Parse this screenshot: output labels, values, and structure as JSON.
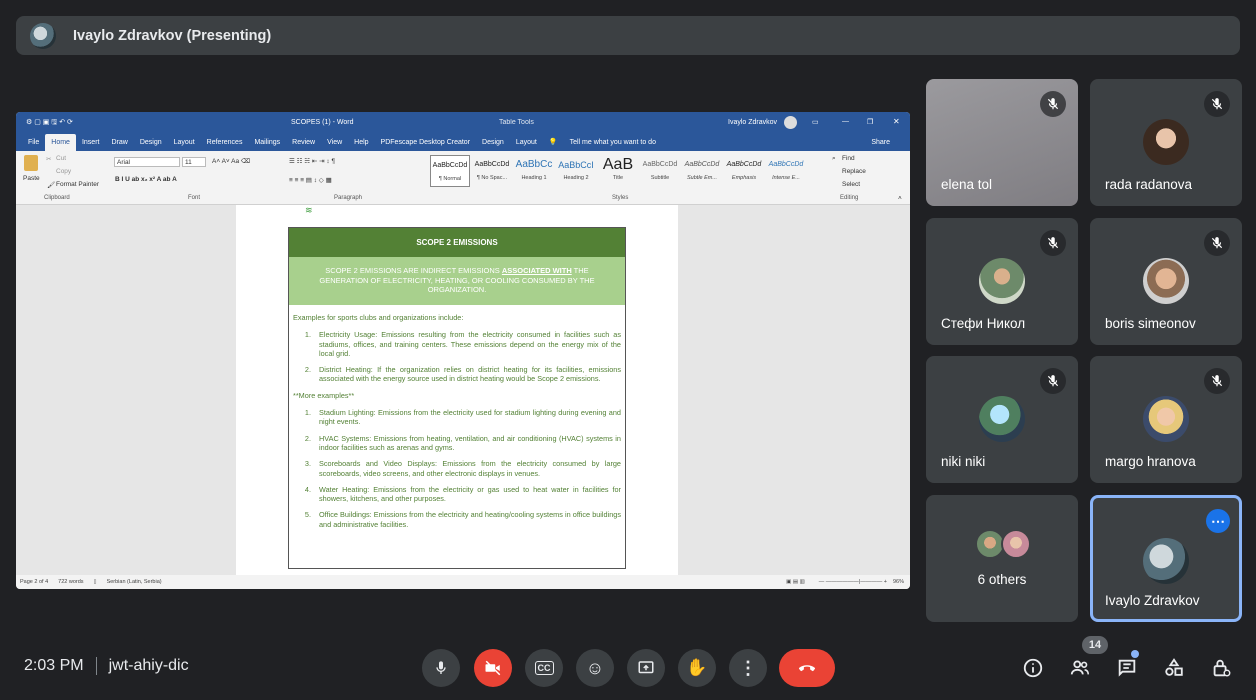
{
  "presenter": {
    "name": "Ivaylo Zdravkov (Presenting)"
  },
  "word": {
    "title": "SCOPES (1) - Word",
    "table_tools": "Table Tools",
    "user": "Ivaylo Zdravkov",
    "tabs": [
      "File",
      "Home",
      "Insert",
      "Draw",
      "Design",
      "Layout",
      "References",
      "Mailings",
      "Review",
      "View",
      "Help",
      "PDFescape Desktop Creator",
      "Design",
      "Layout"
    ],
    "tell_me": "Tell me what you want to do",
    "share": "Share",
    "clipboard": {
      "paste": "Paste",
      "cut": "Cut",
      "copy": "Copy",
      "format_painter": "Format Painter",
      "label": "Clipboard"
    },
    "font": {
      "name": "Arial",
      "size": "11",
      "label": "Font"
    },
    "paragraph_label": "Paragraph",
    "styles_label": "Styles",
    "editing": {
      "find": "Find",
      "replace": "Replace",
      "select": "Select",
      "label": "Editing"
    },
    "styles": [
      {
        "sample": "AaBbCcDd",
        "name": "¶ Normal"
      },
      {
        "sample": "AaBbCcDd",
        "name": "¶ No Spac..."
      },
      {
        "sample": "AaBbCc",
        "name": "Heading 1"
      },
      {
        "sample": "AaBbCcI",
        "name": "Heading 2"
      },
      {
        "sample": "AaB",
        "name": "Title"
      },
      {
        "sample": "AaBbCcDd",
        "name": "Subtitle"
      },
      {
        "sample": "AaBbCcDd",
        "name": "Subtle Em..."
      },
      {
        "sample": "AaBbCcDd",
        "name": "Emphasis"
      },
      {
        "sample": "AaBbCcDd",
        "name": "Intense E..."
      }
    ],
    "status": {
      "page": "Page 2 of 4",
      "words": "722 words",
      "language": "Serbian (Latin, Serbia)",
      "zoom": "96%"
    },
    "doc": {
      "heading": "SCOPE 2 EMISSIONS",
      "intro_pre": "SCOPE 2 EMISSIONS ARE INDIRECT EMISSIONS ",
      "intro_emph": "ASSOCIATED WITH",
      "intro_post": " THE GENERATION OF ELECTRICITY, HEATING, OR COOLING CONSUMED BY THE ORGANIZATION.",
      "examples_intro": "Examples for sports clubs and organizations include:",
      "list1": [
        {
          "n": "1.",
          "t": "Electricity Usage: Emissions resulting from the electricity consumed in facilities such as stadiums, offices, and training centers. These emissions depend on the energy mix of the local grid."
        },
        {
          "n": "2.",
          "t": "District Heating: If the organization relies on district heating for its facilities, emissions associated with the energy source used in district heating would be Scope 2 emissions."
        }
      ],
      "more": "**More examples**",
      "list2": [
        {
          "n": "1.",
          "t": "Stadium Lighting: Emissions from the electricity used for stadium lighting during evening and night events."
        },
        {
          "n": "2.",
          "t": "HVAC Systems: Emissions from heating, ventilation, and air conditioning (HVAC) systems in indoor facilities such as arenas and gyms."
        },
        {
          "n": "3.",
          "t": "Scoreboards and Video Displays: Emissions from the electricity consumed by large scoreboards, video screens, and other electronic displays in venues."
        },
        {
          "n": "4.",
          "t": "Water Heating: Emissions from the electricity or gas used to heat water in facilities for showers, kitchens, and other purposes."
        },
        {
          "n": "5.",
          "t": "Office Buildings: Emissions from the electricity and heating/cooling systems in office buildings and administrative facilities."
        }
      ]
    }
  },
  "participants": [
    {
      "name": "elena tol"
    },
    {
      "name": "rada radanova"
    },
    {
      "name": "Стефи Никол"
    },
    {
      "name": "boris simeonov"
    },
    {
      "name": "niki niki"
    },
    {
      "name": "margo hranova"
    },
    {
      "name": "6 others"
    },
    {
      "name": "Ivaylo Zdravkov"
    }
  ],
  "meeting": {
    "time": "2:03 PM",
    "code": "jwt-ahiy-dic",
    "people_count": "14"
  },
  "colors": {
    "end_call": "#ea4335",
    "cam_off": "#ea4335",
    "accent": "#8ab4f8",
    "doc_green": "#538135",
    "doc_light_green": "#a8d08d"
  }
}
